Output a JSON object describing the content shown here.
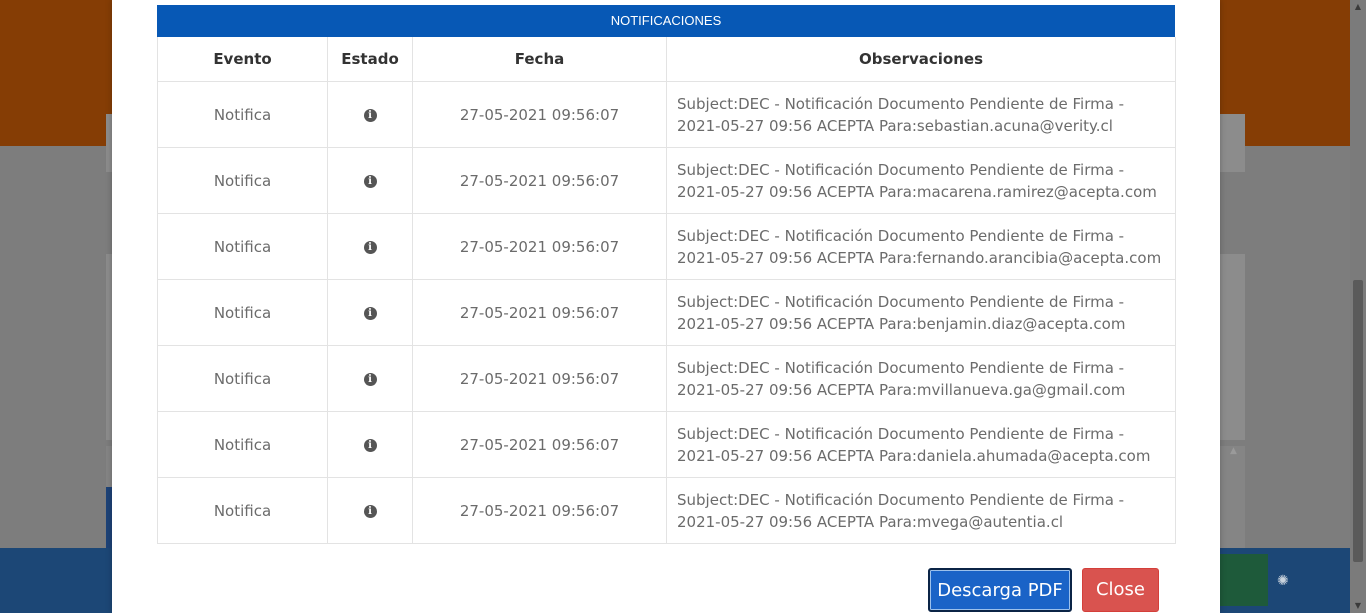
{
  "modal": {
    "panel_title": "NOTIFICACIONES",
    "columns": [
      "Evento",
      "Estado",
      "Fecha",
      "Observaciones"
    ],
    "rows": [
      {
        "evento": "Notifica",
        "estado_icon": "info-circle-icon",
        "fecha": "27-05-2021 09:56:07",
        "observaciones": "Subject:DEC - Notificación Documento Pendiente de Firma - 2021-05-27 09:56 ACEPTA Para:sebastian.acuna@verity.cl"
      },
      {
        "evento": "Notifica",
        "estado_icon": "info-circle-icon",
        "fecha": "27-05-2021 09:56:07",
        "observaciones": "Subject:DEC - Notificación Documento Pendiente de Firma - 2021-05-27 09:56 ACEPTA Para:macarena.ramirez@acepta.com"
      },
      {
        "evento": "Notifica",
        "estado_icon": "info-circle-icon",
        "fecha": "27-05-2021 09:56:07",
        "observaciones": "Subject:DEC - Notificación Documento Pendiente de Firma - 2021-05-27 09:56 ACEPTA Para:fernando.arancibia@acepta.com"
      },
      {
        "evento": "Notifica",
        "estado_icon": "info-circle-icon",
        "fecha": "27-05-2021 09:56:07",
        "observaciones": "Subject:DEC - Notificación Documento Pendiente de Firma - 2021-05-27 09:56 ACEPTA Para:benjamin.diaz@acepta.com"
      },
      {
        "evento": "Notifica",
        "estado_icon": "info-circle-icon",
        "fecha": "27-05-2021 09:56:07",
        "observaciones": "Subject:DEC - Notificación Documento Pendiente de Firma - 2021-05-27 09:56 ACEPTA Para:mvillanueva.ga@gmail.com"
      },
      {
        "evento": "Notifica",
        "estado_icon": "info-circle-icon",
        "fecha": "27-05-2021 09:56:07",
        "observaciones": "Subject:DEC - Notificación Documento Pendiente de Firma - 2021-05-27 09:56 ACEPTA Para:daniela.ahumada@acepta.com"
      },
      {
        "evento": "Notifica",
        "estado_icon": "info-circle-icon",
        "fecha": "27-05-2021 09:56:07",
        "observaciones": "Subject:DEC - Notificación Documento Pendiente de Firma - 2021-05-27 09:56 ACEPTA Para:mvega@autentia.cl"
      }
    ],
    "buttons": {
      "download_pdf": "Descarga PDF",
      "close": "Close"
    }
  },
  "colors": {
    "panel_heading": "#0758b5",
    "primary_button": "#1a63c7",
    "danger_button": "#d9534f",
    "backdrop_header": "#853d05",
    "backdrop_footer": "#1c4776"
  }
}
